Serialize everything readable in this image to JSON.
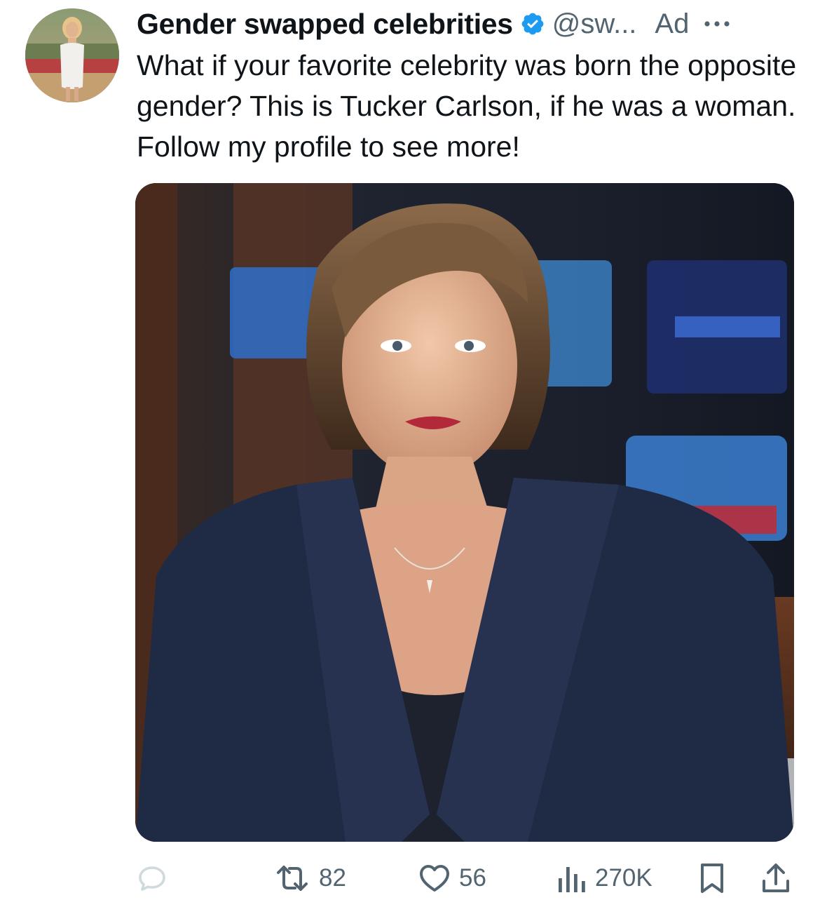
{
  "post": {
    "display_name": "Gender swapped celebrities",
    "handle": "@sw...",
    "ad_label": "Ad",
    "text": "What if your favorite celebrity was born the opposite gender? This is Tucker Carlson, if he was a woman. Follow my profile to see more!"
  },
  "actions": {
    "reply_count": "",
    "repost_count": "82",
    "like_count": "56",
    "views_count": "270K"
  },
  "icons": {
    "verified": "verified-badge-icon",
    "more": "more-dots-icon",
    "reply": "reply-icon",
    "repost": "repost-icon",
    "like": "heart-icon",
    "views": "views-bar-chart-icon",
    "bookmark": "bookmark-icon",
    "share": "share-icon"
  },
  "colors": {
    "verified_blue": "#1d9bf0",
    "secondary_text": "#536471",
    "primary_text": "#0f1419"
  }
}
